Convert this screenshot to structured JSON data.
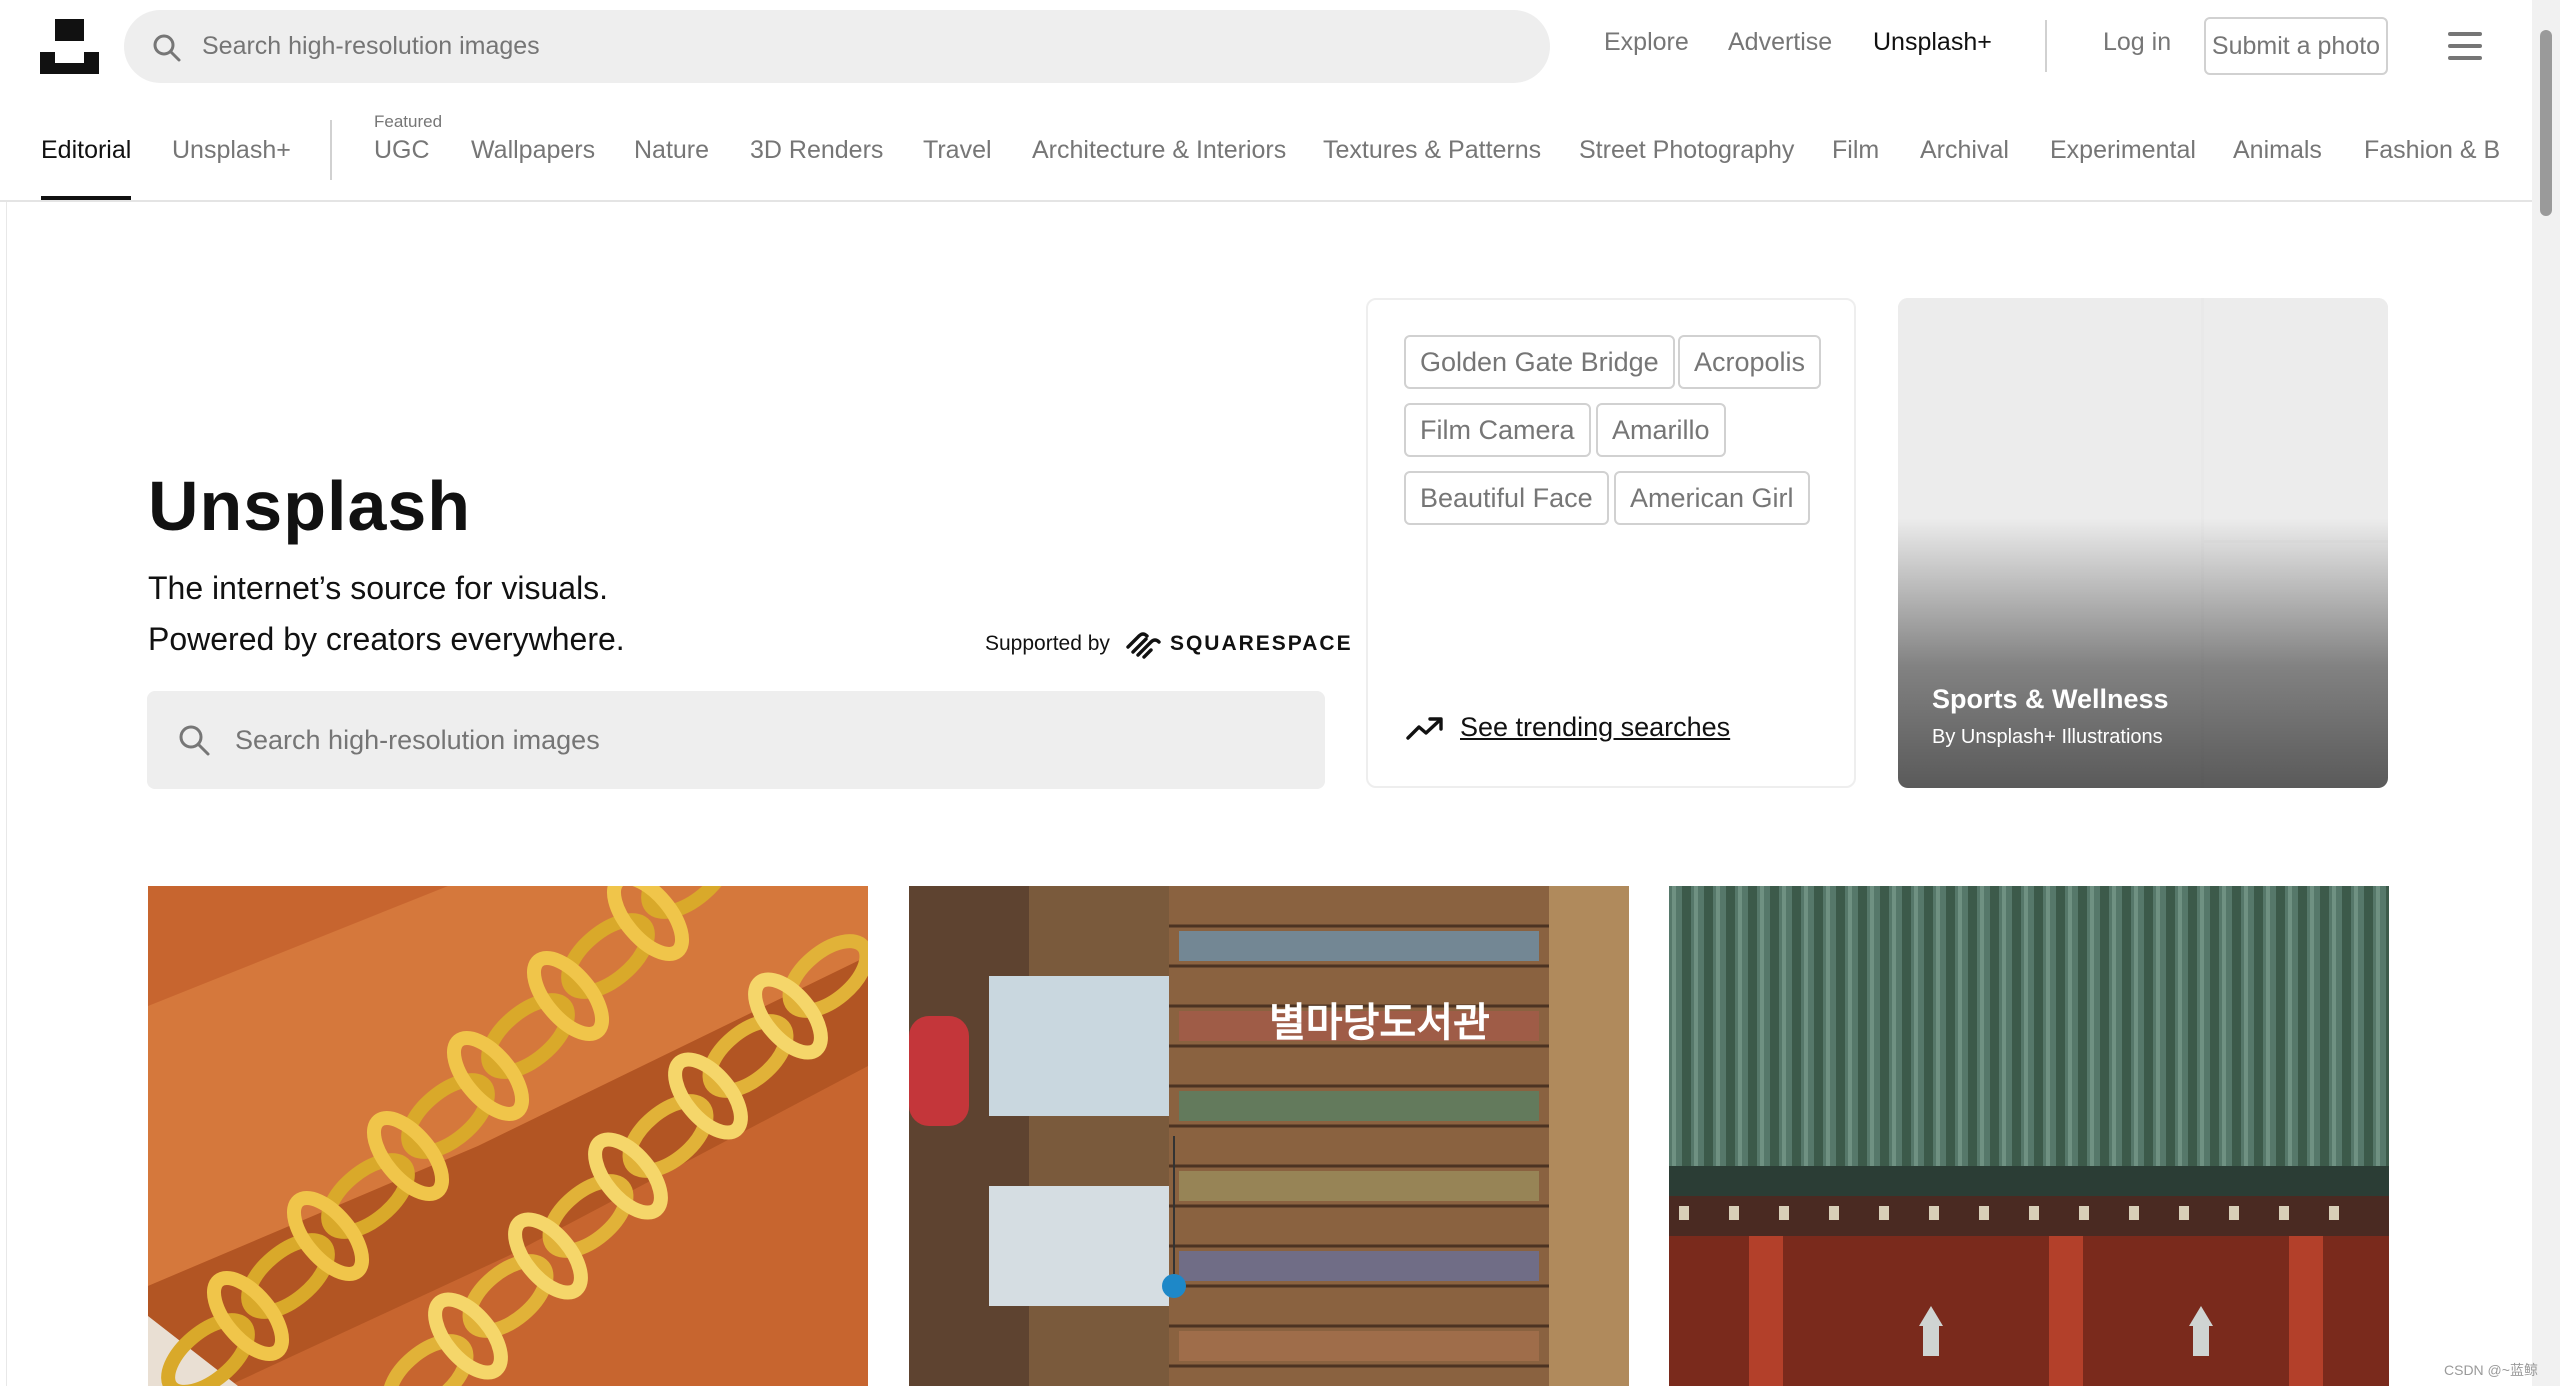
{
  "topbar": {
    "search_placeholder": "Search high-resolution images",
    "nav": {
      "explore": "Explore",
      "advertise": "Advertise",
      "unsplash_plus": "Unsplash+",
      "login": "Log in",
      "submit_photo": "Submit a photo"
    }
  },
  "categories": {
    "editorial": "Editorial",
    "unsplash_plus": "Unsplash+",
    "featured_label": "Featured",
    "items": [
      "UGC",
      "Wallpapers",
      "Nature",
      "3D Renders",
      "Travel",
      "Architecture & Interiors",
      "Textures & Patterns",
      "Street Photography",
      "Film",
      "Archival",
      "Experimental",
      "Animals",
      "Fashion & B"
    ]
  },
  "hero": {
    "title": "Unsplash",
    "subtitle_1": "The internet’s source for visuals.",
    "subtitle_2": "Powered by creators everywhere.",
    "supported_by": "Supported by",
    "sponsor": "SQUARESPACE",
    "search_placeholder": "Search high-resolution images"
  },
  "trending": {
    "chips": [
      "Golden Gate Bridge",
      "Acropolis",
      "Film Camera",
      "Amarillo",
      "Beautiful Face",
      "American Girl"
    ],
    "link": "See trending searches"
  },
  "collection": {
    "title": "Sports & Wellness",
    "byline": "By Unsplash+ Illustrations"
  },
  "photos": {
    "library_sign": "별마당도서관"
  },
  "watermark": "CSDN @~蓝鲸"
}
